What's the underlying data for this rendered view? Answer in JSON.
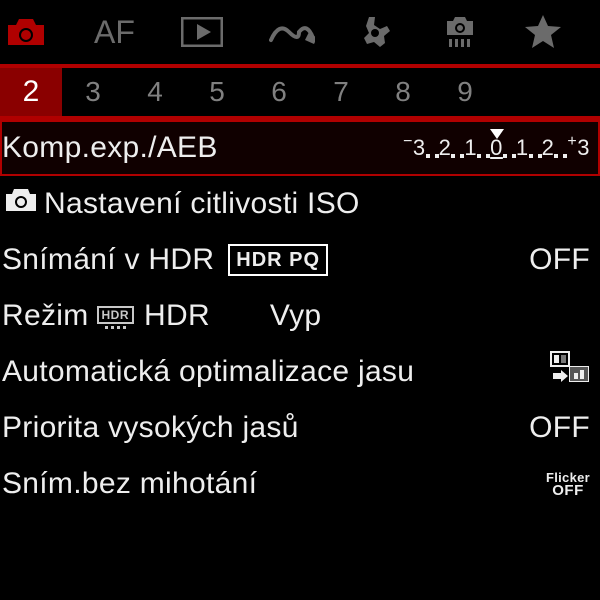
{
  "topTabs": [
    "shoot",
    "af",
    "play",
    "network",
    "setup",
    "custom",
    "mymenu"
  ],
  "pages": [
    "2",
    "3",
    "4",
    "5",
    "6",
    "7",
    "8",
    "9"
  ],
  "selectedPage": "2",
  "rows": {
    "aeb": {
      "label": "Komp.exp./AEB",
      "scale": {
        "minus": "−",
        "plus": "+",
        "vals": [
          "3",
          "2",
          "1",
          "0",
          "1",
          "2",
          "3"
        ]
      }
    },
    "iso": {
      "label": "Nastavení citlivosti ISO"
    },
    "hdrpq": {
      "label": "Snímání v HDR",
      "badge": "HDR PQ",
      "value": "OFF"
    },
    "hdr": {
      "prefix": "Režim",
      "box": "HDR",
      "label": "HDR",
      "value": "Vyp"
    },
    "alo": {
      "label": "Automatická optimalizace jasu"
    },
    "htp": {
      "label": "Priorita vysokých jasů",
      "value": "OFF"
    },
    "flicker": {
      "label": "Sním.bez mihotání",
      "badgeTop": "Flicker",
      "badgeBottom": "OFF"
    }
  }
}
